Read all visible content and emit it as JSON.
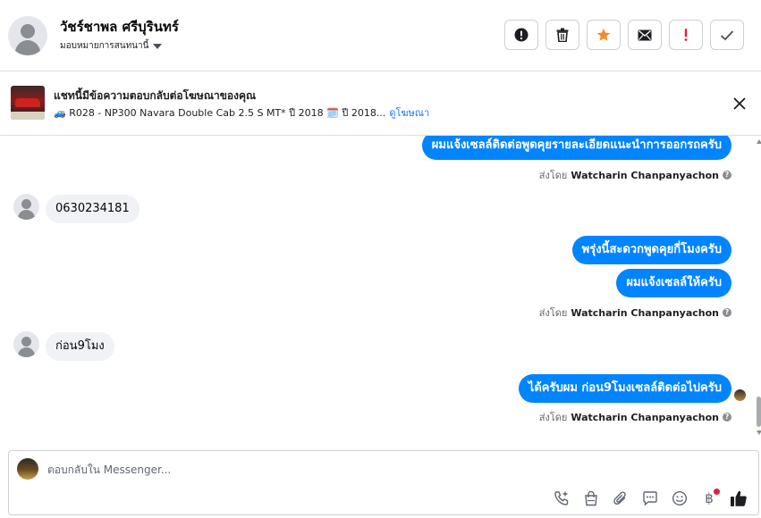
{
  "header": {
    "contact_name": "วัชร์ชาพล ศรีบุรินทร์",
    "assign_label": "มอบหมายการสนทนานี้",
    "actions": [
      {
        "name": "mark-spam-button",
        "icon": "exclamation-circle-icon"
      },
      {
        "name": "delete-button",
        "icon": "trash-icon"
      },
      {
        "name": "star-button",
        "icon": "star-icon",
        "color": "#f28c28"
      },
      {
        "name": "mark-unread-button",
        "icon": "envelope-icon"
      },
      {
        "name": "mark-important-button",
        "icon": "exclamation-icon",
        "color": "#e41e3f"
      },
      {
        "name": "mark-done-button",
        "icon": "check-icon"
      }
    ]
  },
  "ad_banner": {
    "title": "แชทนี้มีข้อความตอบกลับต่อโฆษณาของคุณ",
    "description": "🚙 R028 - NP300 Navara Double Cab 2.5 S MT* ปี 2018 🗓️ ปี 2018...",
    "link_label": "ดูโฆษณา"
  },
  "messages": [
    {
      "dir": "out",
      "text": "ผมแจ้งเซลล์ติดต่อพูดคุยรายละเอียดแนะนำการออกรถครับ"
    },
    {
      "dir": "sent_by",
      "prefix": "ส่งโดย",
      "name": "Watcharin Chanpanyachon"
    },
    {
      "dir": "in",
      "text": "0630234181"
    },
    {
      "dir": "out",
      "text": "พรุ่งนี้สะดวกพูดคุยกี่โมงครับ"
    },
    {
      "dir": "out",
      "text": "ผมแจ้งเซลล์ให้ครับ"
    },
    {
      "dir": "sent_by",
      "prefix": "ส่งโดย",
      "name": "Watcharin Chanpanyachon"
    },
    {
      "dir": "in",
      "text": "ก่อน9โมง"
    },
    {
      "dir": "out",
      "text": "ได้ครับผม ก่อน9โมงเซลล์ติดต่อไปครับ"
    },
    {
      "dir": "sent_by",
      "prefix": "ส่งโดย",
      "name": "Watcharin Chanpanyachon"
    }
  ],
  "composer": {
    "placeholder": "ตอบกลับใน Messenger...",
    "tools": [
      "phone-plus-icon",
      "shopping-bag-icon",
      "paperclip-icon",
      "saved-reply-icon",
      "emoji-icon",
      "baht-payment-icon",
      "thumbs-up-icon"
    ],
    "baht_symbol": "฿",
    "accent": "#1877f2"
  }
}
